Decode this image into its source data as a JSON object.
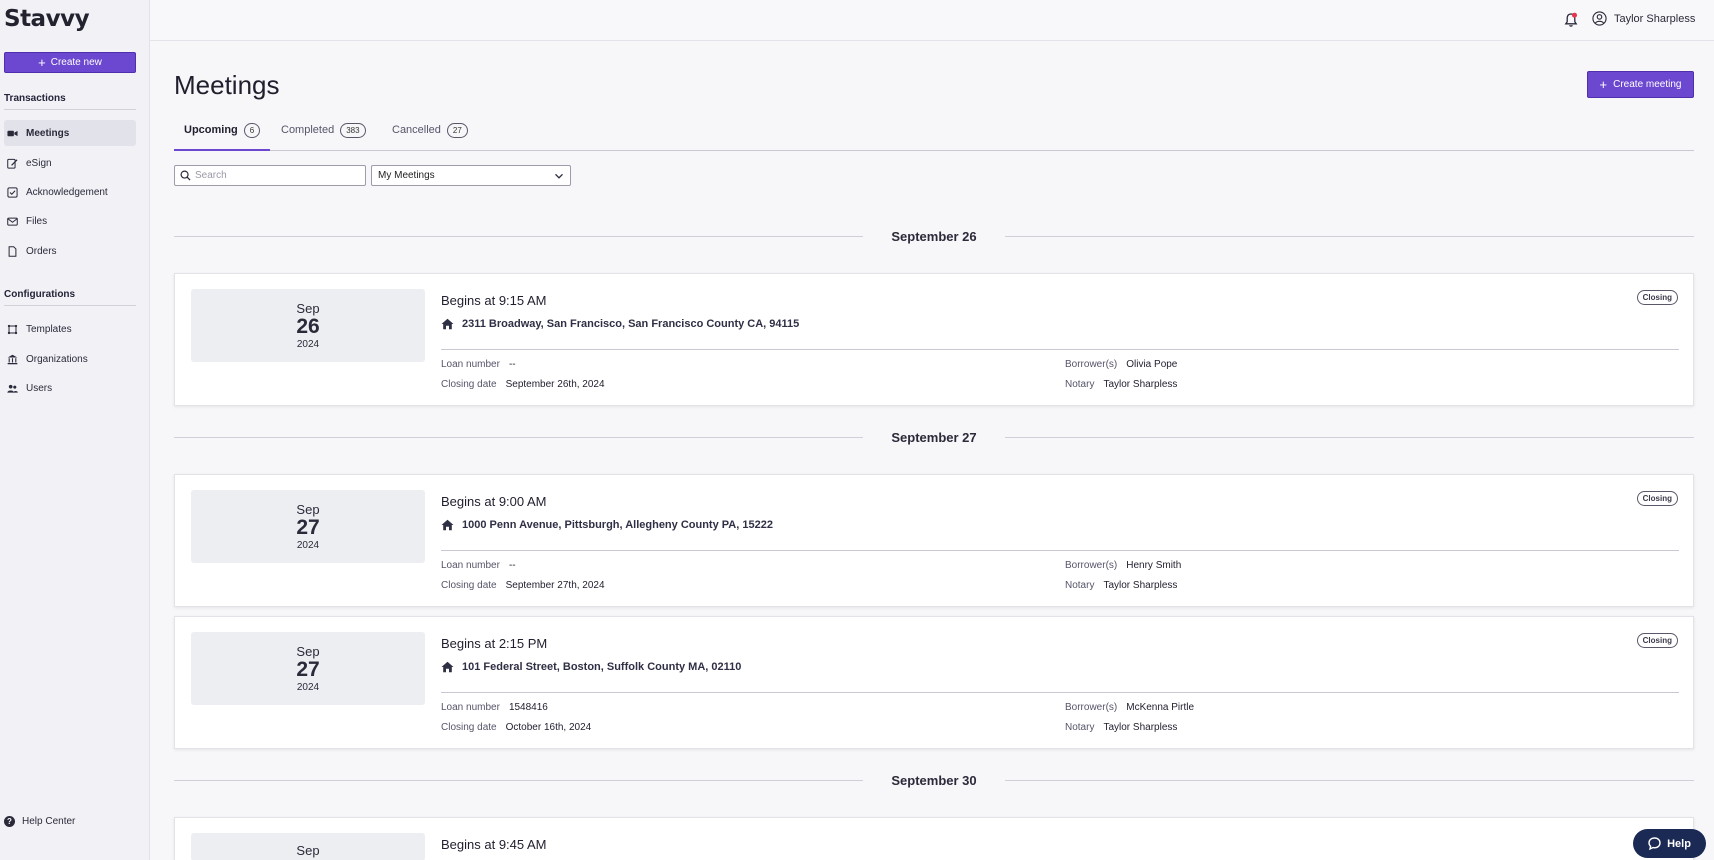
{
  "app": {
    "logo": "Stavvy",
    "brand_color": "#6c47d0"
  },
  "sidebar": {
    "create_new_label": "Create new",
    "transactions_title": "Transactions",
    "transactions": [
      {
        "label": "Meetings",
        "icon": "video-icon",
        "active": true
      },
      {
        "label": "eSign",
        "icon": "sign-icon"
      },
      {
        "label": "Acknowledgement",
        "icon": "checkbox-icon"
      },
      {
        "label": "Files",
        "icon": "envelope-icon"
      },
      {
        "label": "Orders",
        "icon": "document-icon"
      }
    ],
    "configurations_title": "Configurations",
    "configurations": [
      {
        "label": "Templates",
        "icon": "template-icon"
      },
      {
        "label": "Organizations",
        "icon": "bank-icon"
      },
      {
        "label": "Users",
        "icon": "users-icon"
      }
    ],
    "help_center_label": "Help Center"
  },
  "topbar": {
    "user_name": "Taylor Sharpless"
  },
  "main": {
    "title": "Meetings",
    "create_meeting_label": "Create meeting",
    "tabs": [
      {
        "label": "Upcoming",
        "count": "6",
        "active": true
      },
      {
        "label": "Completed",
        "count": "383"
      },
      {
        "label": "Cancelled",
        "count": "27"
      }
    ],
    "search_placeholder": "Search",
    "filter_selected": "My Meetings",
    "groups": [
      {
        "label": "September 26"
      },
      {
        "label": "September 27"
      },
      {
        "label": "September 30"
      }
    ],
    "labels": {
      "loan_number": "Loan number",
      "closing_date": "Closing date",
      "borrowers": "Borrower(s)",
      "notary": "Notary"
    },
    "meetings": [
      {
        "month": "Sep",
        "day": "26",
        "year": "2024",
        "begins": "Begins at 9:15 AM",
        "address": "2311 Broadway, San Francisco, San Francisco County CA, 94115",
        "loan_number": "--",
        "closing_date": "September 26th, 2024",
        "borrowers": "Olivia Pope",
        "notary": "Taylor Sharpless",
        "badge": "Closing"
      },
      {
        "month": "Sep",
        "day": "27",
        "year": "2024",
        "begins": "Begins at 9:00 AM",
        "address": "1000 Penn Avenue, Pittsburgh, Allegheny County PA, 15222",
        "loan_number": "--",
        "closing_date": "September 27th, 2024",
        "borrowers": "Henry Smith",
        "notary": "Taylor Sharpless",
        "badge": "Closing"
      },
      {
        "month": "Sep",
        "day": "27",
        "year": "2024",
        "begins": "Begins at 2:15 PM",
        "address": "101 Federal Street, Boston, Suffolk County MA, 02110",
        "loan_number": "1548416",
        "closing_date": "October 16th, 2024",
        "borrowers": "McKenna Pirtle",
        "notary": "Taylor Sharpless",
        "badge": "Closing"
      },
      {
        "month": "Sep",
        "begins": "Begins at 9:45 AM"
      }
    ]
  },
  "help_button_label": "Help"
}
